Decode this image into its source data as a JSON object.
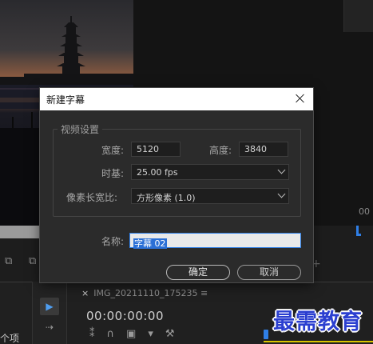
{
  "dialog": {
    "title": "新建字幕",
    "group_label": "视频设置",
    "width_label": "宽度:",
    "width_value": "5120",
    "height_label": "高度:",
    "height_value": "3840",
    "timebase_label": "时基:",
    "timebase_value": "25.00 fps",
    "pixel_aspect_label": "像素长宽比:",
    "pixel_aspect_value": "方形像素 (1.0)",
    "name_label": "名称:",
    "name_value": "字幕 02",
    "ok_label": "确定",
    "cancel_label": "取消"
  },
  "background": {
    "sequence_tab": "IMG_20211110_175235",
    "timecode": "00:00:00:00",
    "items_label": "个项",
    "program_tc_partial": "0",
    "right_tc_partial": "00"
  },
  "watermark": "最需教育",
  "colors": {
    "accent": "#2f7fe6",
    "dialog_bg": "#2b2b2b",
    "watermark": "#2b3fd0"
  },
  "icons": [
    "close-icon",
    "chevron-down-icon",
    "selection-tool-icon",
    "track-select-icon",
    "playhead-icon",
    "wrench-icon",
    "magnet-icon",
    "marker-icon",
    "add-icon"
  ]
}
